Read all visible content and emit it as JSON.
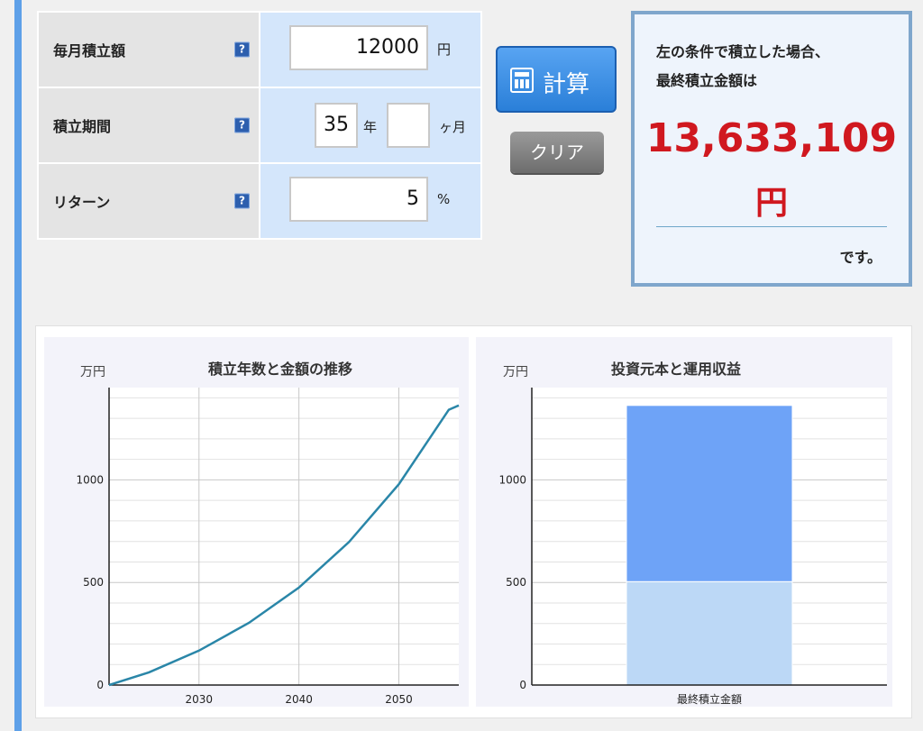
{
  "form": {
    "monthly": {
      "label": "毎月積立額",
      "value": "12000",
      "unit": "円"
    },
    "period": {
      "label": "積立期間",
      "years": "35",
      "years_unit": "年",
      "months": "",
      "months_unit": "ヶ月"
    },
    "return": {
      "label": "リターン",
      "value": "5",
      "unit": "%"
    },
    "help_glyph": "?"
  },
  "buttons": {
    "calculate": "計算",
    "clear": "クリア"
  },
  "result": {
    "line1": "左の条件で積立した場合、",
    "line2": "最終積立金額は",
    "amount": "13,633,109",
    "amount_unit": "円",
    "suffix": "です。"
  },
  "colors": {
    "accent": "#2a7fd8",
    "result_red": "#d0181f",
    "line": "#2a86a8",
    "bar_principal": "#bcd8f6",
    "bar_gain": "#6ea3f7"
  },
  "chart_data": [
    {
      "type": "line",
      "title": "積立年数と金額の推移",
      "ylabel": "万円",
      "x_ticks": [
        "2030",
        "2040",
        "2050"
      ],
      "y_ticks": [
        "0",
        "500",
        "1000"
      ],
      "xlim": [
        2021,
        2056
      ],
      "ylim": [
        0,
        1450
      ],
      "x": [
        2021,
        2025,
        2030,
        2035,
        2040,
        2045,
        2050,
        2055,
        2056
      ],
      "values": [
        0,
        62,
        168,
        303,
        475,
        697,
        979,
        1342,
        1363
      ]
    },
    {
      "type": "bar",
      "title": "投資元本と運用収益",
      "ylabel": "万円",
      "categories": [
        "最終積立金額"
      ],
      "y_ticks": [
        "0",
        "500",
        "1000"
      ],
      "ylim": [
        0,
        1450
      ],
      "stack": [
        {
          "values": [
            504
          ]
        },
        {
          "values": [
            859
          ]
        }
      ]
    }
  ]
}
